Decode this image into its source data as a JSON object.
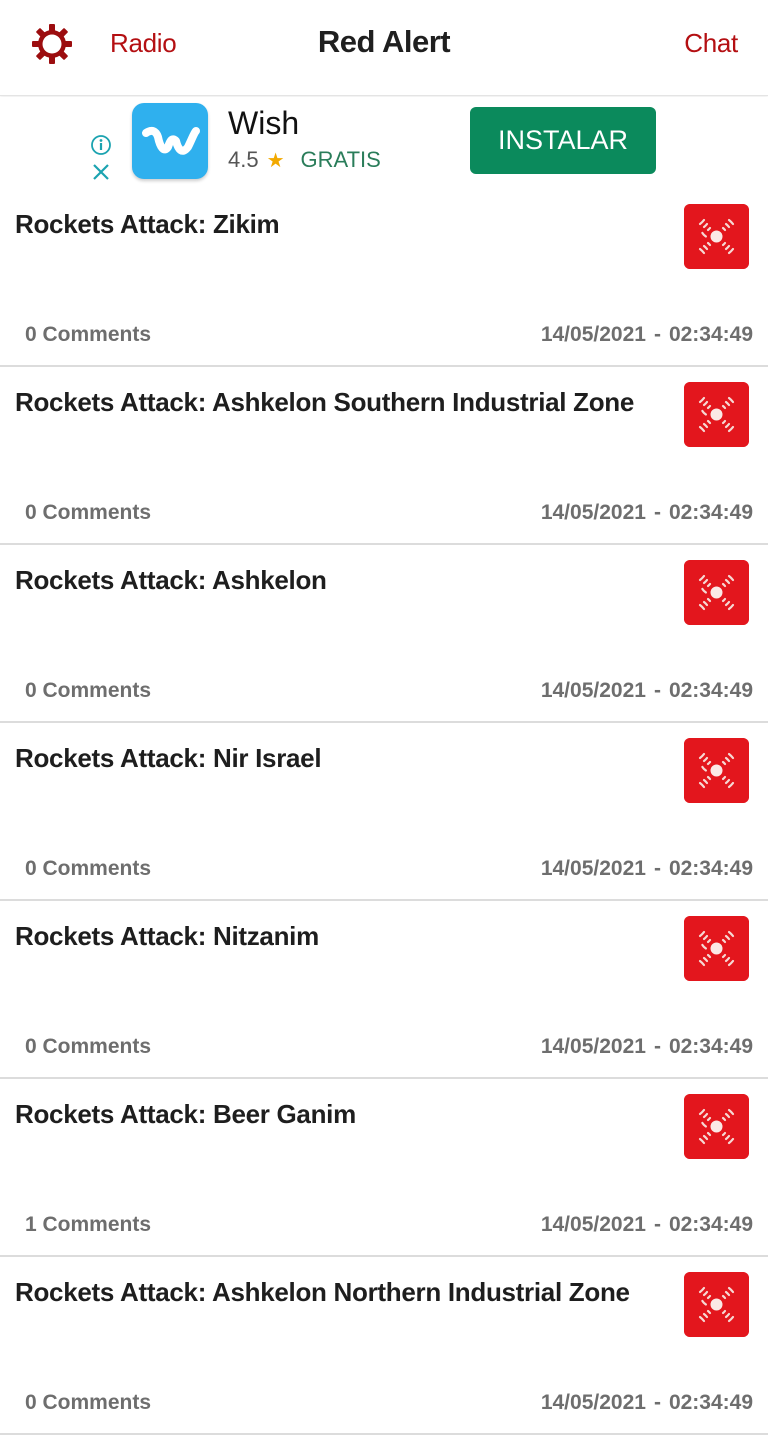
{
  "header": {
    "title": "Red Alert",
    "left_link": "Radio",
    "right_link": "Chat",
    "settings_icon": "gear-icon",
    "accent_color": "#b40f12"
  },
  "ad": {
    "app_name": "Wish",
    "rating": "4.5",
    "rating_icon": "star-icon",
    "price": "GRATIS",
    "install_label": "INSTALAR",
    "info_icon": "info-icon",
    "close_icon": "close-icon"
  },
  "alerts": [
    {
      "title": "Rockets Attack: Zikim",
      "comments": "0 Comments",
      "date": "14/05/2021",
      "time": "02:34:49"
    },
    {
      "title": "Rockets Attack: Ashkelon Southern Industrial Zone",
      "comments": "0 Comments",
      "date": "14/05/2021",
      "time": "02:34:49"
    },
    {
      "title": "Rockets Attack: Ashkelon",
      "comments": "0 Comments",
      "date": "14/05/2021",
      "time": "02:34:49"
    },
    {
      "title": "Rockets Attack: Nir Israel",
      "comments": "0 Comments",
      "date": "14/05/2021",
      "time": "02:34:49"
    },
    {
      "title": "Rockets Attack: Nitzanim",
      "comments": "0 Comments",
      "date": "14/05/2021",
      "time": "02:34:49"
    },
    {
      "title": "Rockets Attack: Beer Ganim",
      "comments": "1 Comments",
      "date": "14/05/2021",
      "time": "02:34:49"
    },
    {
      "title": "Rockets Attack: Ashkelon Northern Industrial Zone",
      "comments": "0 Comments",
      "date": "14/05/2021",
      "time": "02:34:49"
    }
  ],
  "date_separator": "-",
  "alert_icon": "siren-icon",
  "alert_icon_color": "#e3161d"
}
